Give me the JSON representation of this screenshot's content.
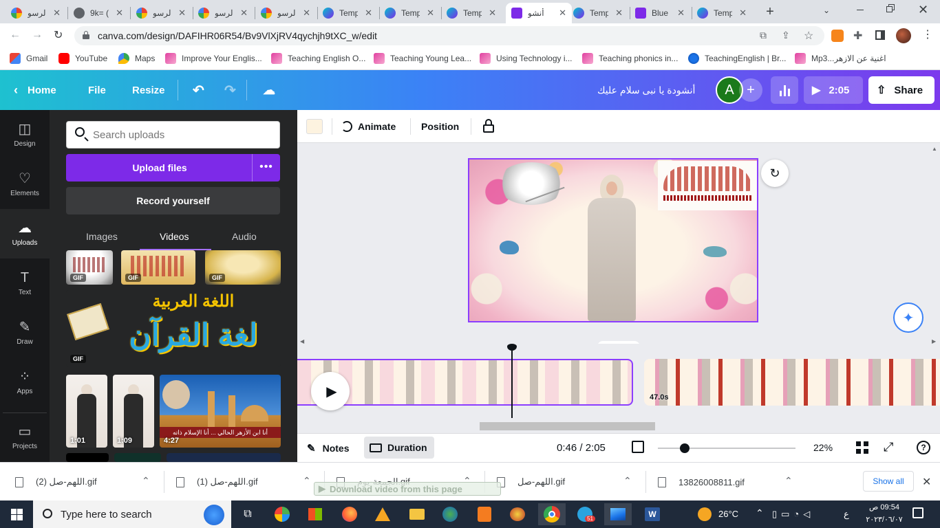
{
  "browser": {
    "tabs": [
      {
        "title": "الرسو",
        "icon": "google-icon",
        "active": false
      },
      {
        "title": "9k= (",
        "icon": "globe-icon",
        "active": false
      },
      {
        "title": "الرسو",
        "icon": "google-icon",
        "active": false
      },
      {
        "title": "الرسو",
        "icon": "google-icon",
        "active": false
      },
      {
        "title": "الرسو",
        "icon": "google-icon",
        "active": false
      },
      {
        "title": "Temp",
        "icon": "canva-icon",
        "active": false
      },
      {
        "title": "Temp",
        "icon": "canva-icon",
        "active": false
      },
      {
        "title": "Temp",
        "icon": "canva-icon",
        "active": false
      },
      {
        "title": "أنشو",
        "icon": "canva-video-icon",
        "active": true
      },
      {
        "title": "Temp",
        "icon": "canva-icon",
        "active": false
      },
      {
        "title": "Blue",
        "icon": "canva-video-icon",
        "active": false
      },
      {
        "title": "Temp",
        "icon": "canva-icon",
        "active": false
      }
    ],
    "url": "canva.com/design/DAFIHR06R54/Bv9VlXjRV4qychjh9tXC_w/edit",
    "bookmarks": [
      {
        "label": "Gmail",
        "icon": "gmail-icon"
      },
      {
        "label": "YouTube",
        "icon": "youtube-icon"
      },
      {
        "label": "Maps",
        "icon": "maps-icon"
      },
      {
        "label": "Improve Your Englis...",
        "icon": "bookmark-icon"
      },
      {
        "label": "Teaching English O...",
        "icon": "bookmark-icon"
      },
      {
        "label": "Teaching Young Lea...",
        "icon": "bookmark-icon"
      },
      {
        "label": "Using Technology i...",
        "icon": "bookmark-icon"
      },
      {
        "label": "Teaching phonics in...",
        "icon": "bookmark-icon"
      },
      {
        "label": "TeachingEnglish | Br...",
        "icon": "teachingenglish-icon"
      },
      {
        "label": "Mp3...اغنية عن الازهر",
        "icon": "bookmark-icon"
      }
    ]
  },
  "canva": {
    "header": {
      "home": "Home",
      "file": "File",
      "resize": "Resize",
      "design_title": "أنشودة يا نبى سلام عليك",
      "avatar_letter": "A",
      "play_time": "2:05",
      "share": "Share"
    },
    "rail": [
      {
        "label": "Design",
        "icon": "design-icon",
        "active": false
      },
      {
        "label": "Elements",
        "icon": "elements-icon",
        "active": false
      },
      {
        "label": "Uploads",
        "icon": "uploads-icon",
        "active": true
      },
      {
        "label": "Text",
        "icon": "text-icon",
        "active": false
      },
      {
        "label": "Draw",
        "icon": "draw-icon",
        "active": false
      },
      {
        "label": "Apps",
        "icon": "apps-icon",
        "active": false
      },
      {
        "label": "Projects",
        "icon": "projects-icon",
        "active": false
      }
    ],
    "panel": {
      "search_placeholder": "Search uploads",
      "upload_button": "Upload files",
      "record_button": "Record yourself",
      "tabs": [
        "Images",
        "Videos",
        "Audio"
      ],
      "active_tab": "Videos",
      "gif_badge": "GIF",
      "gif_big_text_top": "اللغة العربية",
      "gif_big_text_bottom": "لغة القرآن",
      "videos": [
        {
          "duration": "1:01"
        },
        {
          "duration": "1:09"
        },
        {
          "duration": "4:27",
          "caption": "أنا ابن الأزهر الحالي ... أنا الإسلام ذاته"
        }
      ]
    },
    "toolbar": {
      "animate": "Animate",
      "position": "Position",
      "swatch_color": "#fdf3e0"
    },
    "timeline": {
      "second_clip_duration": "47.0s"
    },
    "footer": {
      "notes": "Notes",
      "duration": "Duration",
      "time": "0:46 / 2:05",
      "zoom": "22%"
    }
  },
  "downloads": {
    "items": [
      "اللهم-صل (2).gif",
      "اللهم-صل (1).gif",
      "الجمعة-يوم.gif",
      "اللهم-صل.gif",
      "13826008811.gif"
    ],
    "overlay_text": "Download video from this page",
    "show_all": "Show all"
  },
  "taskbar": {
    "search_placeholder": "Type here to search",
    "weather": "26°C",
    "lang": "ع",
    "time": "09:54 ص",
    "date": "٢٠٢٣/٠٦/٠٧",
    "badge": "51"
  },
  "colors": {
    "canva_purple": "#7d2ae8",
    "canvas_border": "#8b3dff",
    "rail_bg": "#18191b",
    "panel_bg": "#252627"
  }
}
